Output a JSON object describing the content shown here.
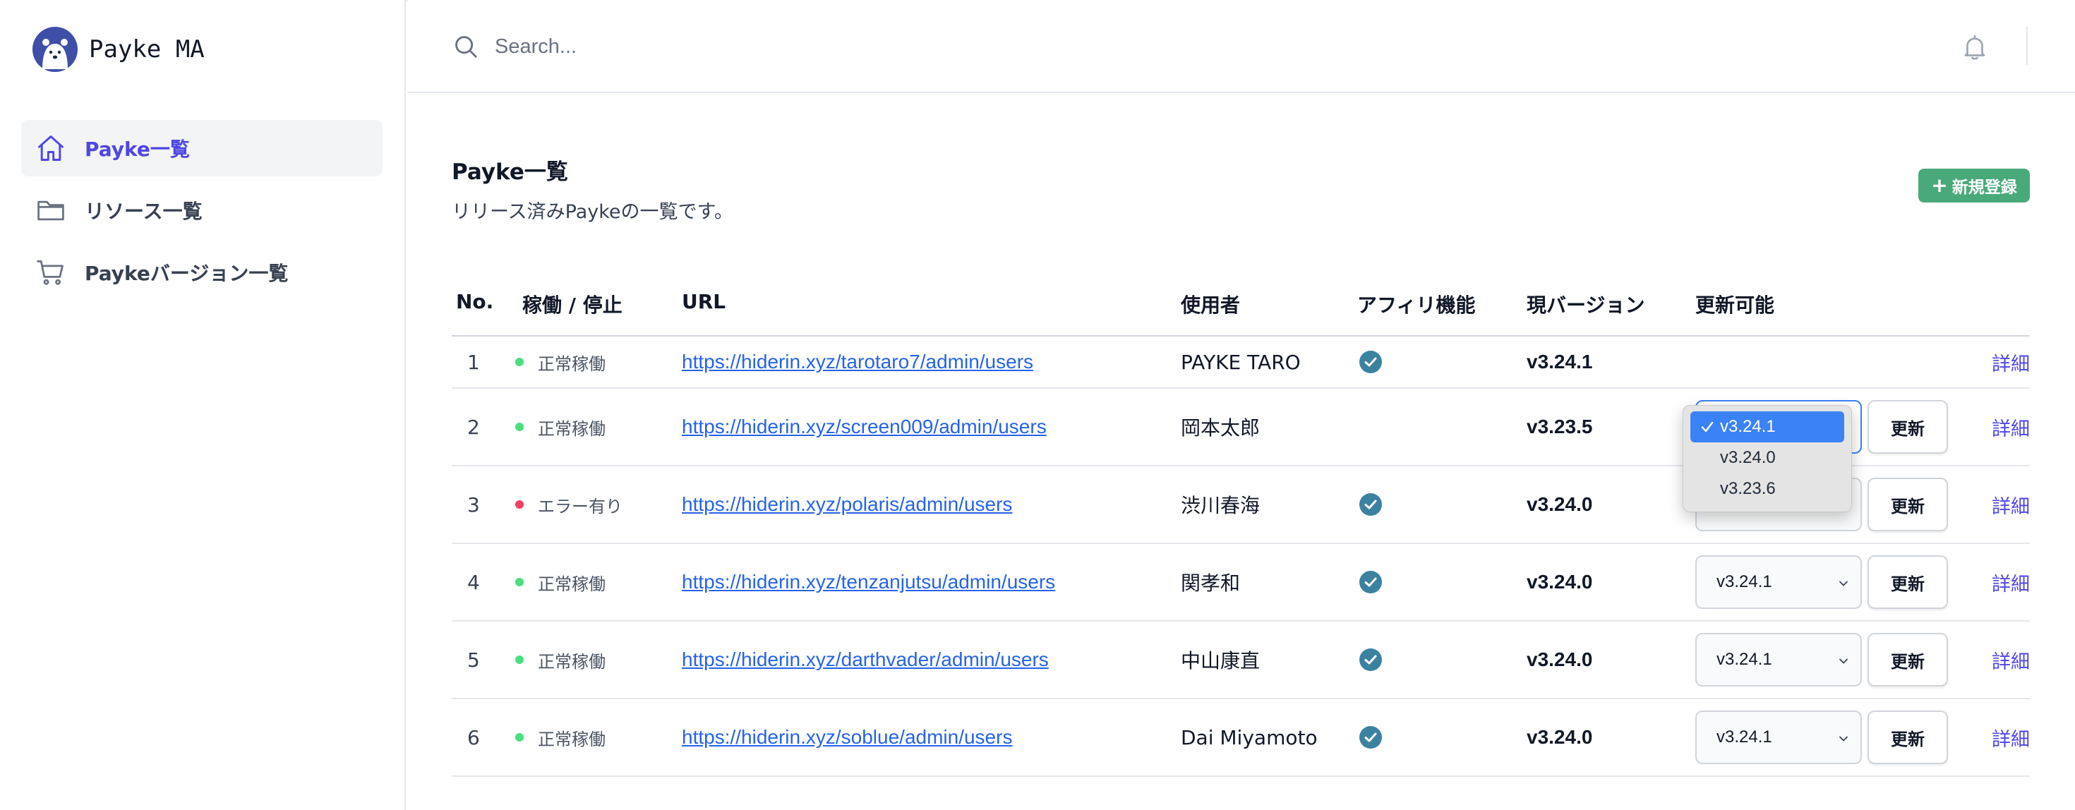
{
  "app": {
    "name": "Payke MA",
    "logo_icon": "polar-bear-logo"
  },
  "sidebar": {
    "items": [
      {
        "label": "Payke一覧",
        "icon": "home-icon",
        "active": true
      },
      {
        "label": "リソース一覧",
        "icon": "folder-icon",
        "active": false
      },
      {
        "label": "Paykeバージョン一覧",
        "icon": "cart-icon",
        "active": false
      }
    ]
  },
  "header": {
    "search_placeholder": "Search...",
    "search_icon": "search-icon",
    "bell_icon": "bell-icon"
  },
  "main": {
    "title": "Payke一覧",
    "description": "リリース済みPaykeの一覧です。",
    "new_button": {
      "plus": "+",
      "label": "新規登録",
      "color": "#4aa97a"
    }
  },
  "table": {
    "columns": [
      "No.",
      "稼働 / 停止",
      "URL",
      "使用者",
      "アフィリ機能",
      "現バージョン",
      "更新可能"
    ],
    "update_label": "更新",
    "detail_label": "詳細",
    "rows": [
      {
        "no": "1",
        "status": "正常稼働",
        "status_color": "#4ade80",
        "url": "https://hiderin.xyz/tarotaro7/admin/users",
        "user": "PAYKE TARO",
        "affiliate": true,
        "version": "v3.24.1",
        "updatable": false,
        "selected": ""
      },
      {
        "no": "2",
        "status": "正常稼働",
        "status_color": "#4ade80",
        "url": "https://hiderin.xyz/screen009/admin/users",
        "user": "岡本太郎",
        "affiliate": false,
        "version": "v3.23.5",
        "updatable": true,
        "selected": "v3.24.1"
      },
      {
        "no": "3",
        "status": "エラー有り",
        "status_color": "#f43f5e",
        "url": "https://hiderin.xyz/polaris/admin/users",
        "user": "渋川春海",
        "affiliate": true,
        "version": "v3.24.0",
        "updatable": true,
        "selected": "v3.24.1"
      },
      {
        "no": "4",
        "status": "正常稼働",
        "status_color": "#4ade80",
        "url": "https://hiderin.xyz/tenzanjutsu/admin/users",
        "user": "関孝和",
        "affiliate": true,
        "version": "v3.24.0",
        "updatable": true,
        "selected": "v3.24.1"
      },
      {
        "no": "5",
        "status": "正常稼働",
        "status_color": "#4ade80",
        "url": "https://hiderin.xyz/darthvader/admin/users",
        "user": "中山康直",
        "affiliate": true,
        "version": "v3.24.0",
        "updatable": true,
        "selected": "v3.24.1"
      },
      {
        "no": "6",
        "status": "正常稼働",
        "status_color": "#4ade80",
        "url": "https://hiderin.xyz/soblue/admin/users",
        "user": "Dai Miyamoto",
        "affiliate": true,
        "version": "v3.24.0",
        "updatable": true,
        "selected": "v3.24.1"
      }
    ]
  },
  "dropdown": {
    "open_for_row": "2",
    "options": [
      "v3.24.1",
      "v3.24.0",
      "v3.23.6"
    ],
    "selected": "v3.24.1"
  },
  "colors": {
    "accent": "#4f46e5",
    "link": "#2563eb",
    "check": "#3b82a0",
    "select_highlight": "#3b82f6"
  }
}
